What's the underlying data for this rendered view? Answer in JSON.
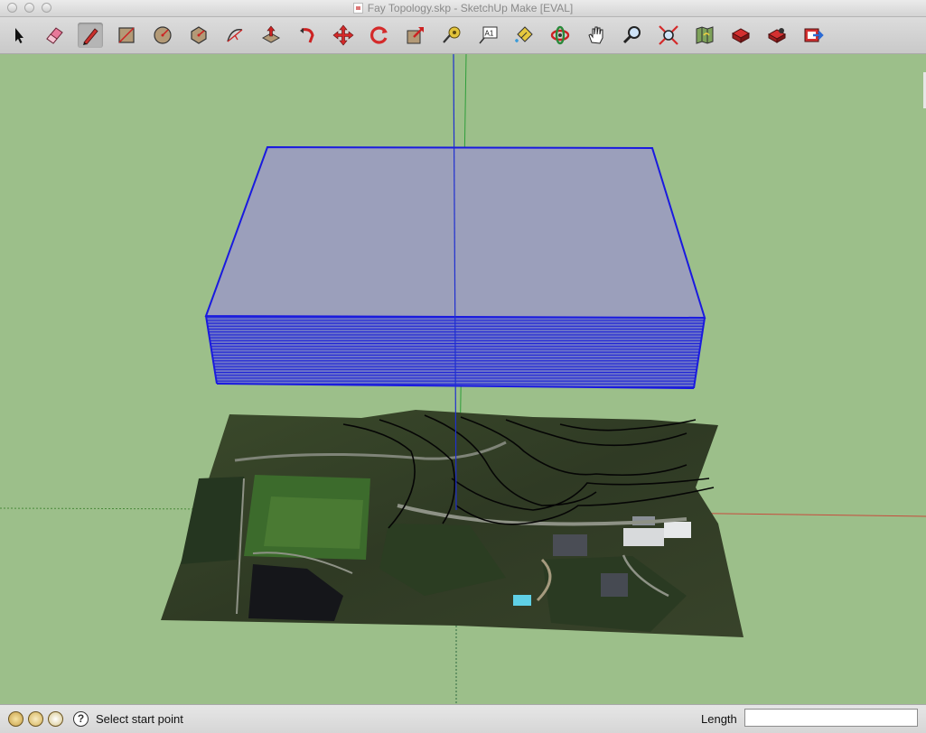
{
  "window": {
    "title": "Fay Topology.skp - SketchUp Make [EVAL]"
  },
  "toolbar": {
    "tools": [
      {
        "name": "select-tool",
        "icon": "arrow-icon"
      },
      {
        "name": "eraser-tool",
        "icon": "eraser-icon"
      },
      {
        "name": "line-tool",
        "icon": "pencil-icon",
        "active": true
      },
      {
        "name": "rectangle-tool",
        "icon": "rectangle-icon"
      },
      {
        "name": "circle-tool",
        "icon": "circle-icon"
      },
      {
        "name": "polygon-tool",
        "icon": "polygon-icon"
      },
      {
        "name": "arc-tool",
        "icon": "arc-icon"
      },
      {
        "name": "push-pull-tool",
        "icon": "push-pull-icon"
      },
      {
        "name": "follow-me-tool",
        "icon": "follow-me-icon"
      },
      {
        "name": "move-tool",
        "icon": "move-icon"
      },
      {
        "name": "rotate-tool",
        "icon": "rotate-icon"
      },
      {
        "name": "scale-tool",
        "icon": "scale-icon"
      },
      {
        "name": "tape-measure-tool",
        "icon": "tape-measure-icon"
      },
      {
        "name": "text-tool",
        "icon": "text-icon",
        "label": "A1"
      },
      {
        "name": "paint-bucket-tool",
        "icon": "paint-bucket-icon"
      },
      {
        "name": "orbit-tool",
        "icon": "orbit-icon"
      },
      {
        "name": "pan-tool",
        "icon": "hand-icon"
      },
      {
        "name": "zoom-tool",
        "icon": "magnifier-icon"
      },
      {
        "name": "zoom-extents-tool",
        "icon": "zoom-extents-icon"
      },
      {
        "name": "get-photo-texture-tool",
        "icon": "map-icon"
      },
      {
        "name": "warehouse-tool",
        "icon": "warehouse-icon"
      },
      {
        "name": "share-model-tool",
        "icon": "share-model-icon"
      },
      {
        "name": "extension-warehouse-tool",
        "icon": "extension-warehouse-icon"
      }
    ]
  },
  "colors": {
    "background": "#9cbf8a",
    "selection": "#1a1adf",
    "box_top": "#9b9fbb",
    "red_axis": "#c84b3c",
    "green_axis": "#2e9e3a",
    "blue_axis": "#1f2fd0"
  },
  "status": {
    "message": "Select start point",
    "length_label": "Length",
    "length_value": ""
  }
}
